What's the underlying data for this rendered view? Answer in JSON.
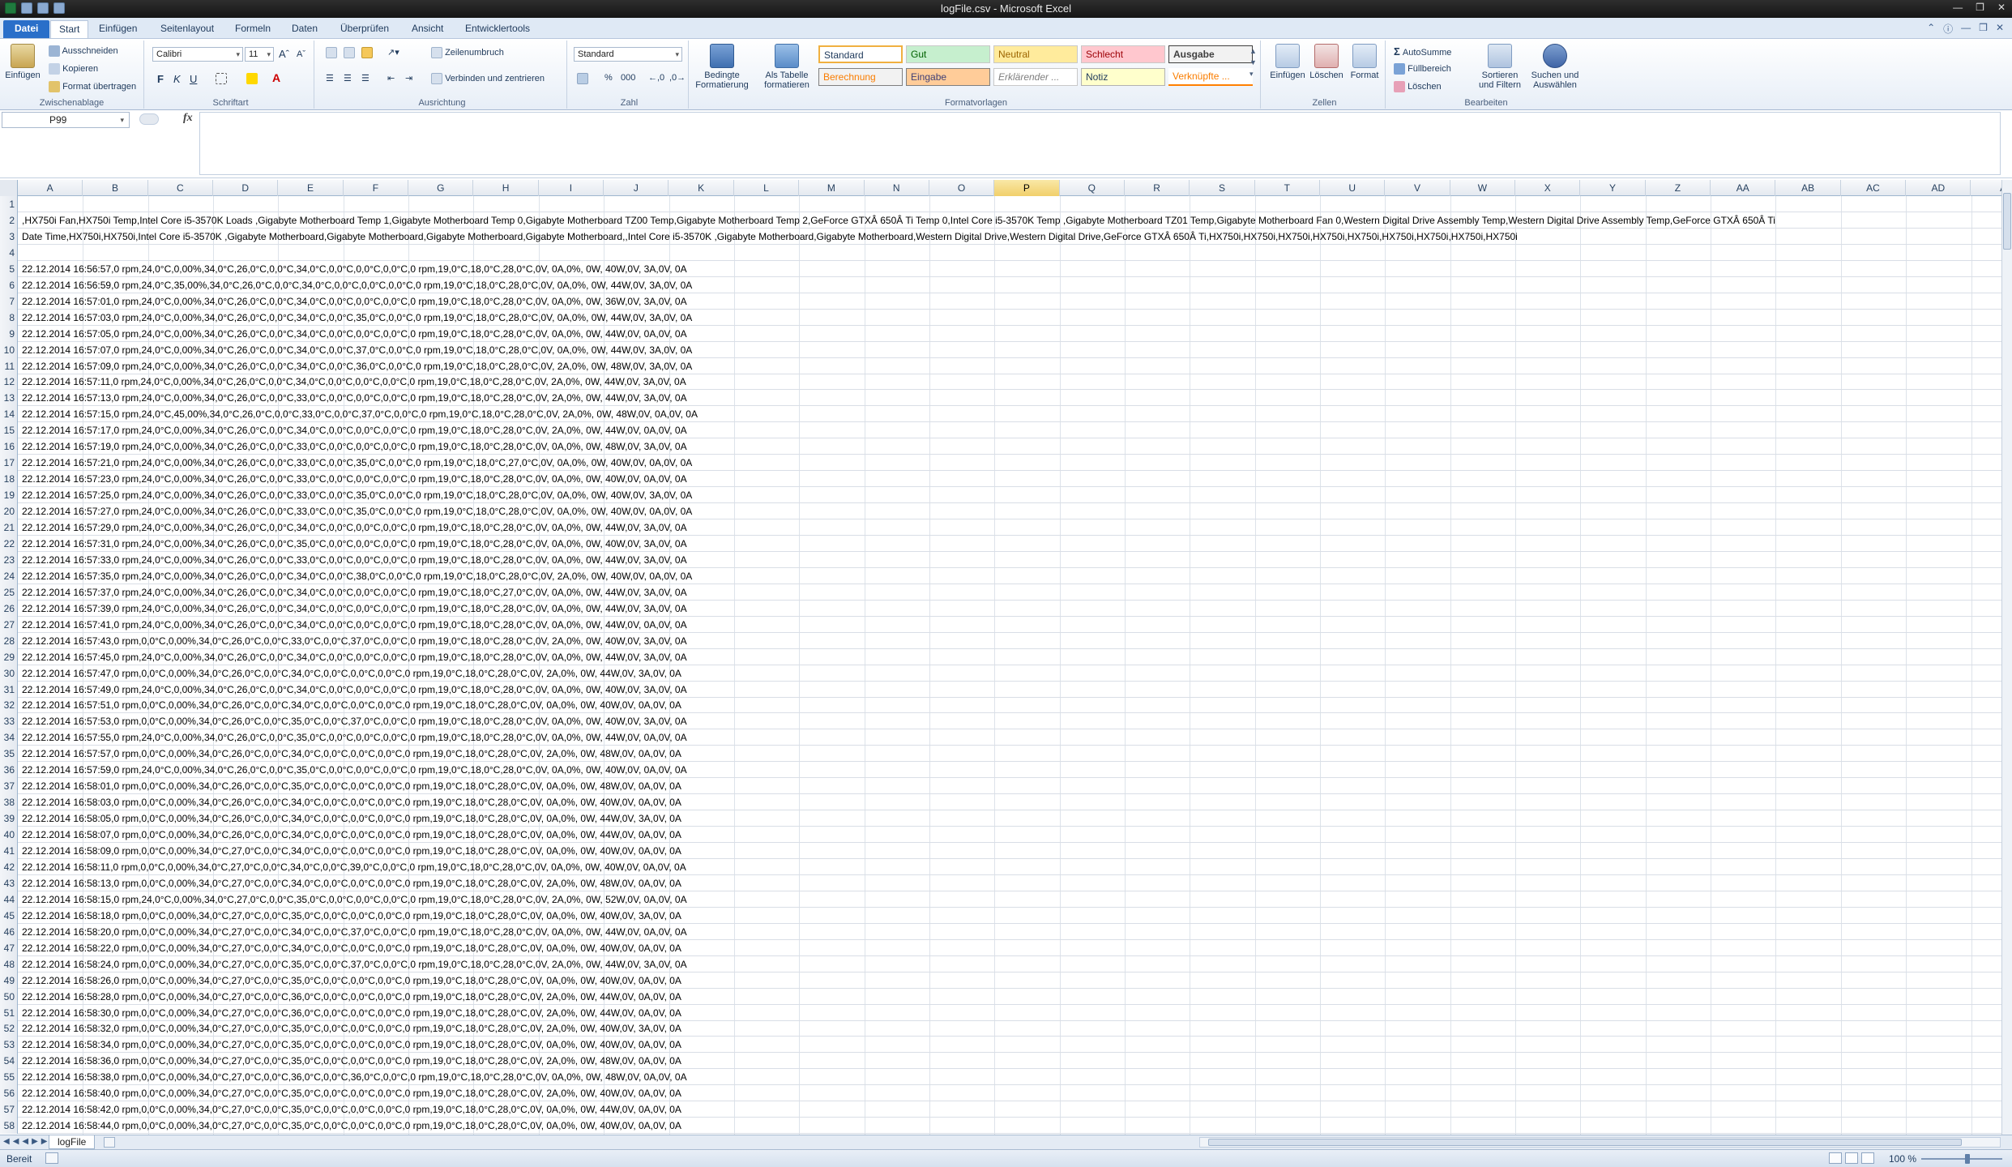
{
  "window": {
    "title": "logFile.csv - Microsoft Excel"
  },
  "tabs": [
    "Datei",
    "Start",
    "Einfügen",
    "Seitenlayout",
    "Formeln",
    "Daten",
    "Überprüfen",
    "Ansicht",
    "Entwicklertools"
  ],
  "ribbon": {
    "clipboard": {
      "paste": "Einfügen",
      "cut": "Ausschneiden",
      "copy": "Kopieren",
      "format_painter": "Format übertragen",
      "label": "Zwischenablage"
    },
    "font": {
      "family": "Calibri",
      "size": "11",
      "bold": "F",
      "italic": "K",
      "underline": "U",
      "label": "Schriftart"
    },
    "alignment": {
      "wrap": "Zeilenumbruch",
      "merge": "Verbinden und zentrieren",
      "label": "Ausrichtung"
    },
    "number": {
      "format": "Standard",
      "percent": "%",
      "thousands": "000",
      "label": "Zahl"
    },
    "styles": {
      "conditional": "Bedingte Formatierung",
      "table": "Als Tabelle formatieren",
      "label": "Formatvorlagen",
      "items": [
        "Standard",
        "Gut",
        "Neutral",
        "Schlecht",
        "Ausgabe",
        "Berechnung",
        "Eingabe",
        "Erklärender ...",
        "Notiz",
        "Verknüpfte ..."
      ]
    },
    "cells": {
      "insert": "Einfügen",
      "delete": "Löschen",
      "format": "Format",
      "label": "Zellen"
    },
    "editing": {
      "autosum": "AutoSumme",
      "fill": "Füllbereich",
      "clear": "Löschen",
      "sort": "Sortieren und Filtern",
      "find": "Suchen und Auswählen",
      "label": "Bearbeiten"
    }
  },
  "formula_bar": {
    "name_box": "P99",
    "fx": "fx",
    "formula": ""
  },
  "columns": [
    "A",
    "B",
    "C",
    "D",
    "E",
    "F",
    "G",
    "H",
    "I",
    "J",
    "K",
    "L",
    "M",
    "N",
    "O",
    "P",
    "Q",
    "R",
    "S",
    "T",
    "U",
    "V",
    "W",
    "X",
    "Y",
    "Z",
    "AA",
    "AB",
    "AC",
    "AD",
    "A"
  ],
  "selected_column": "P",
  "rows": [
    {
      "n": "1",
      "t": ""
    },
    {
      "n": "2",
      "t": ",HX750i Fan,HX750i Temp,Intel Core i5-3570K Loads ,Gigabyte Motherboard Temp 1,Gigabyte Motherboard Temp 0,Gigabyte Motherboard TZ00 Temp,Gigabyte Motherboard Temp 2,GeForce GTXÂ 650Â Ti Temp 0,Intel Core i5-3570K Temp ,Gigabyte Motherboard TZ01 Temp,Gigabyte Motherboard Fan 0,Western Digital Drive Assembly Temp,Western Digital Drive Assembly Temp,GeForce GTXÂ 650Â Ti"
    },
    {
      "n": "3",
      "t": "Date Time,HX750i,HX750i,Intel Core i5-3570K ,Gigabyte Motherboard,Gigabyte Motherboard,Gigabyte Motherboard,Gigabyte Motherboard,,Intel Core i5-3570K ,Gigabyte Motherboard,Gigabyte Motherboard,Western Digital Drive,Western Digital Drive,GeForce GTXÂ 650Â Ti,HX750i,HX750i,HX750i,HX750i,HX750i,HX750i,HX750i,HX750i,HX750i"
    },
    {
      "n": "4",
      "t": ""
    },
    {
      "n": "5",
      "t": "22.12.2014 16:56:57,0 rpm,24,0°C,0,00%,34,0°C,26,0°C,0,0°C,34,0°C,0,0°C,0,0°C,0,0°C,0 rpm,19,0°C,18,0°C,28,0°C,0V, 0A,0%, 0W, 40W,0V, 3A,0V, 0A"
    },
    {
      "n": "6",
      "t": "22.12.2014 16:56:59,0 rpm,24,0°C,35,00%,34,0°C,26,0°C,0,0°C,34,0°C,0,0°C,0,0°C,0,0°C,0 rpm,19,0°C,18,0°C,28,0°C,0V, 0A,0%, 0W, 44W,0V, 3A,0V, 0A"
    },
    {
      "n": "7",
      "t": "22.12.2014 16:57:01,0 rpm,24,0°C,0,00%,34,0°C,26,0°C,0,0°C,34,0°C,0,0°C,0,0°C,0,0°C,0 rpm,19,0°C,18,0°C,28,0°C,0V, 0A,0%, 0W, 36W,0V, 3A,0V, 0A"
    },
    {
      "n": "8",
      "t": "22.12.2014 16:57:03,0 rpm,24,0°C,0,00%,34,0°C,26,0°C,0,0°C,34,0°C,0,0°C,35,0°C,0,0°C,0 rpm,19,0°C,18,0°C,28,0°C,0V, 0A,0%, 0W, 44W,0V, 3A,0V, 0A"
    },
    {
      "n": "9",
      "t": "22.12.2014 16:57:05,0 rpm,24,0°C,0,00%,34,0°C,26,0°C,0,0°C,34,0°C,0,0°C,0,0°C,0,0°C,0 rpm,19,0°C,18,0°C,28,0°C,0V, 0A,0%, 0W, 44W,0V, 0A,0V, 0A"
    },
    {
      "n": "10",
      "t": "22.12.2014 16:57:07,0 rpm,24,0°C,0,00%,34,0°C,26,0°C,0,0°C,34,0°C,0,0°C,37,0°C,0,0°C,0 rpm,19,0°C,18,0°C,28,0°C,0V, 0A,0%, 0W, 44W,0V, 3A,0V, 0A"
    },
    {
      "n": "11",
      "t": "22.12.2014 16:57:09,0 rpm,24,0°C,0,00%,34,0°C,26,0°C,0,0°C,34,0°C,0,0°C,36,0°C,0,0°C,0 rpm,19,0°C,18,0°C,28,0°C,0V, 2A,0%, 0W, 48W,0V, 3A,0V, 0A"
    },
    {
      "n": "12",
      "t": "22.12.2014 16:57:11,0 rpm,24,0°C,0,00%,34,0°C,26,0°C,0,0°C,34,0°C,0,0°C,0,0°C,0,0°C,0 rpm,19,0°C,18,0°C,28,0°C,0V, 2A,0%, 0W, 44W,0V, 3A,0V, 0A"
    },
    {
      "n": "13",
      "t": "22.12.2014 16:57:13,0 rpm,24,0°C,0,00%,34,0°C,26,0°C,0,0°C,33,0°C,0,0°C,0,0°C,0,0°C,0 rpm,19,0°C,18,0°C,28,0°C,0V, 2A,0%, 0W, 44W,0V, 3A,0V, 0A"
    },
    {
      "n": "14",
      "t": "22.12.2014 16:57:15,0 rpm,24,0°C,45,00%,34,0°C,26,0°C,0,0°C,33,0°C,0,0°C,37,0°C,0,0°C,0 rpm,19,0°C,18,0°C,28,0°C,0V, 2A,0%, 0W, 48W,0V, 0A,0V, 0A"
    },
    {
      "n": "15",
      "t": "22.12.2014 16:57:17,0 rpm,24,0°C,0,00%,34,0°C,26,0°C,0,0°C,34,0°C,0,0°C,0,0°C,0,0°C,0 rpm,19,0°C,18,0°C,28,0°C,0V, 2A,0%, 0W, 44W,0V, 0A,0V, 0A"
    },
    {
      "n": "16",
      "t": "22.12.2014 16:57:19,0 rpm,24,0°C,0,00%,34,0°C,26,0°C,0,0°C,33,0°C,0,0°C,0,0°C,0,0°C,0 rpm,19,0°C,18,0°C,28,0°C,0V, 0A,0%, 0W, 48W,0V, 3A,0V, 0A"
    },
    {
      "n": "17",
      "t": "22.12.2014 16:57:21,0 rpm,24,0°C,0,00%,34,0°C,26,0°C,0,0°C,33,0°C,0,0°C,35,0°C,0,0°C,0 rpm,19,0°C,18,0°C,27,0°C,0V, 0A,0%, 0W, 40W,0V, 0A,0V, 0A"
    },
    {
      "n": "18",
      "t": "22.12.2014 16:57:23,0 rpm,24,0°C,0,00%,34,0°C,26,0°C,0,0°C,33,0°C,0,0°C,0,0°C,0,0°C,0 rpm,19,0°C,18,0°C,28,0°C,0V, 0A,0%, 0W, 40W,0V, 0A,0V, 0A"
    },
    {
      "n": "19",
      "t": "22.12.2014 16:57:25,0 rpm,24,0°C,0,00%,34,0°C,26,0°C,0,0°C,33,0°C,0,0°C,35,0°C,0,0°C,0 rpm,19,0°C,18,0°C,28,0°C,0V, 0A,0%, 0W, 40W,0V, 3A,0V, 0A"
    },
    {
      "n": "20",
      "t": "22.12.2014 16:57:27,0 rpm,24,0°C,0,00%,34,0°C,26,0°C,0,0°C,33,0°C,0,0°C,35,0°C,0,0°C,0 rpm,19,0°C,18,0°C,28,0°C,0V, 0A,0%, 0W, 40W,0V, 0A,0V, 0A"
    },
    {
      "n": "21",
      "t": "22.12.2014 16:57:29,0 rpm,24,0°C,0,00%,34,0°C,26,0°C,0,0°C,34,0°C,0,0°C,0,0°C,0,0°C,0 rpm,19,0°C,18,0°C,28,0°C,0V, 0A,0%, 0W, 44W,0V, 3A,0V, 0A"
    },
    {
      "n": "22",
      "t": "22.12.2014 16:57:31,0 rpm,24,0°C,0,00%,34,0°C,26,0°C,0,0°C,35,0°C,0,0°C,0,0°C,0,0°C,0 rpm,19,0°C,18,0°C,28,0°C,0V, 0A,0%, 0W, 40W,0V, 3A,0V, 0A"
    },
    {
      "n": "23",
      "t": "22.12.2014 16:57:33,0 rpm,24,0°C,0,00%,34,0°C,26,0°C,0,0°C,33,0°C,0,0°C,0,0°C,0,0°C,0 rpm,19,0°C,18,0°C,28,0°C,0V, 0A,0%, 0W, 44W,0V, 3A,0V, 0A"
    },
    {
      "n": "24",
      "t": "22.12.2014 16:57:35,0 rpm,24,0°C,0,00%,34,0°C,26,0°C,0,0°C,34,0°C,0,0°C,38,0°C,0,0°C,0 rpm,19,0°C,18,0°C,28,0°C,0V, 2A,0%, 0W, 40W,0V, 0A,0V, 0A"
    },
    {
      "n": "25",
      "t": "22.12.2014 16:57:37,0 rpm,24,0°C,0,00%,34,0°C,26,0°C,0,0°C,34,0°C,0,0°C,0,0°C,0,0°C,0 rpm,19,0°C,18,0°C,27,0°C,0V, 0A,0%, 0W, 44W,0V, 3A,0V, 0A"
    },
    {
      "n": "26",
      "t": "22.12.2014 16:57:39,0 rpm,24,0°C,0,00%,34,0°C,26,0°C,0,0°C,34,0°C,0,0°C,0,0°C,0,0°C,0 rpm,19,0°C,18,0°C,28,0°C,0V, 0A,0%, 0W, 44W,0V, 3A,0V, 0A"
    },
    {
      "n": "27",
      "t": "22.12.2014 16:57:41,0 rpm,24,0°C,0,00%,34,0°C,26,0°C,0,0°C,34,0°C,0,0°C,0,0°C,0,0°C,0 rpm,19,0°C,18,0°C,28,0°C,0V, 0A,0%, 0W, 44W,0V, 0A,0V, 0A"
    },
    {
      "n": "28",
      "t": "22.12.2014 16:57:43,0 rpm,0,0°C,0,00%,34,0°C,26,0°C,0,0°C,33,0°C,0,0°C,37,0°C,0,0°C,0 rpm,19,0°C,18,0°C,28,0°C,0V, 2A,0%, 0W, 40W,0V, 3A,0V, 0A"
    },
    {
      "n": "29",
      "t": "22.12.2014 16:57:45,0 rpm,24,0°C,0,00%,34,0°C,26,0°C,0,0°C,34,0°C,0,0°C,0,0°C,0,0°C,0 rpm,19,0°C,18,0°C,28,0°C,0V, 0A,0%, 0W, 44W,0V, 3A,0V, 0A"
    },
    {
      "n": "30",
      "t": "22.12.2014 16:57:47,0 rpm,0,0°C,0,00%,34,0°C,26,0°C,0,0°C,34,0°C,0,0°C,0,0°C,0,0°C,0 rpm,19,0°C,18,0°C,28,0°C,0V, 2A,0%, 0W, 44W,0V, 3A,0V, 0A"
    },
    {
      "n": "31",
      "t": "22.12.2014 16:57:49,0 rpm,24,0°C,0,00%,34,0°C,26,0°C,0,0°C,34,0°C,0,0°C,0,0°C,0,0°C,0 rpm,19,0°C,18,0°C,28,0°C,0V, 0A,0%, 0W, 40W,0V, 3A,0V, 0A"
    },
    {
      "n": "32",
      "t": "22.12.2014 16:57:51,0 rpm,0,0°C,0,00%,34,0°C,26,0°C,0,0°C,34,0°C,0,0°C,0,0°C,0,0°C,0 rpm,19,0°C,18,0°C,28,0°C,0V, 0A,0%, 0W, 40W,0V, 0A,0V, 0A"
    },
    {
      "n": "33",
      "t": "22.12.2014 16:57:53,0 rpm,0,0°C,0,00%,34,0°C,26,0°C,0,0°C,35,0°C,0,0°C,37,0°C,0,0°C,0 rpm,19,0°C,18,0°C,28,0°C,0V, 0A,0%, 0W, 40W,0V, 3A,0V, 0A"
    },
    {
      "n": "34",
      "t": "22.12.2014 16:57:55,0 rpm,24,0°C,0,00%,34,0°C,26,0°C,0,0°C,35,0°C,0,0°C,0,0°C,0,0°C,0 rpm,19,0°C,18,0°C,28,0°C,0V, 0A,0%, 0W, 44W,0V, 0A,0V, 0A"
    },
    {
      "n": "35",
      "t": "22.12.2014 16:57:57,0 rpm,0,0°C,0,00%,34,0°C,26,0°C,0,0°C,34,0°C,0,0°C,0,0°C,0,0°C,0 rpm,19,0°C,18,0°C,28,0°C,0V, 2A,0%, 0W, 48W,0V, 0A,0V, 0A"
    },
    {
      "n": "36",
      "t": "22.12.2014 16:57:59,0 rpm,24,0°C,0,00%,34,0°C,26,0°C,0,0°C,35,0°C,0,0°C,0,0°C,0,0°C,0 rpm,19,0°C,18,0°C,28,0°C,0V, 0A,0%, 0W, 40W,0V, 0A,0V, 0A"
    },
    {
      "n": "37",
      "t": "22.12.2014 16:58:01,0 rpm,0,0°C,0,00%,34,0°C,26,0°C,0,0°C,35,0°C,0,0°C,0,0°C,0,0°C,0 rpm,19,0°C,18,0°C,28,0°C,0V, 0A,0%, 0W, 48W,0V, 0A,0V, 0A"
    },
    {
      "n": "38",
      "t": "22.12.2014 16:58:03,0 rpm,0,0°C,0,00%,34,0°C,26,0°C,0,0°C,34,0°C,0,0°C,0,0°C,0,0°C,0 rpm,19,0°C,18,0°C,28,0°C,0V, 0A,0%, 0W, 40W,0V, 0A,0V, 0A"
    },
    {
      "n": "39",
      "t": "22.12.2014 16:58:05,0 rpm,0,0°C,0,00%,34,0°C,26,0°C,0,0°C,34,0°C,0,0°C,0,0°C,0,0°C,0 rpm,19,0°C,18,0°C,28,0°C,0V, 0A,0%, 0W, 44W,0V, 3A,0V, 0A"
    },
    {
      "n": "40",
      "t": "22.12.2014 16:58:07,0 rpm,0,0°C,0,00%,34,0°C,26,0°C,0,0°C,34,0°C,0,0°C,0,0°C,0,0°C,0 rpm,19,0°C,18,0°C,28,0°C,0V, 0A,0%, 0W, 44W,0V, 0A,0V, 0A"
    },
    {
      "n": "41",
      "t": "22.12.2014 16:58:09,0 rpm,0,0°C,0,00%,34,0°C,27,0°C,0,0°C,34,0°C,0,0°C,0,0°C,0,0°C,0 rpm,19,0°C,18,0°C,28,0°C,0V, 0A,0%, 0W, 40W,0V, 0A,0V, 0A"
    },
    {
      "n": "42",
      "t": "22.12.2014 16:58:11,0 rpm,0,0°C,0,00%,34,0°C,27,0°C,0,0°C,34,0°C,0,0°C,39,0°C,0,0°C,0 rpm,19,0°C,18,0°C,28,0°C,0V, 0A,0%, 0W, 40W,0V, 0A,0V, 0A"
    },
    {
      "n": "43",
      "t": "22.12.2014 16:58:13,0 rpm,0,0°C,0,00%,34,0°C,27,0°C,0,0°C,34,0°C,0,0°C,0,0°C,0,0°C,0 rpm,19,0°C,18,0°C,28,0°C,0V, 2A,0%, 0W, 48W,0V, 0A,0V, 0A"
    },
    {
      "n": "44",
      "t": "22.12.2014 16:58:15,0 rpm,24,0°C,0,00%,34,0°C,27,0°C,0,0°C,35,0°C,0,0°C,0,0°C,0,0°C,0 rpm,19,0°C,18,0°C,28,0°C,0V, 2A,0%, 0W, 52W,0V, 0A,0V, 0A"
    },
    {
      "n": "45",
      "t": "22.12.2014 16:58:18,0 rpm,0,0°C,0,00%,34,0°C,27,0°C,0,0°C,35,0°C,0,0°C,0,0°C,0,0°C,0 rpm,19,0°C,18,0°C,28,0°C,0V, 0A,0%, 0W, 40W,0V, 3A,0V, 0A"
    },
    {
      "n": "46",
      "t": "22.12.2014 16:58:20,0 rpm,0,0°C,0,00%,34,0°C,27,0°C,0,0°C,34,0°C,0,0°C,37,0°C,0,0°C,0 rpm,19,0°C,18,0°C,28,0°C,0V, 0A,0%, 0W, 44W,0V, 0A,0V, 0A"
    },
    {
      "n": "47",
      "t": "22.12.2014 16:58:22,0 rpm,0,0°C,0,00%,34,0°C,27,0°C,0,0°C,34,0°C,0,0°C,0,0°C,0,0°C,0 rpm,19,0°C,18,0°C,28,0°C,0V, 0A,0%, 0W, 40W,0V, 0A,0V, 0A"
    },
    {
      "n": "48",
      "t": "22.12.2014 16:58:24,0 rpm,0,0°C,0,00%,34,0°C,27,0°C,0,0°C,35,0°C,0,0°C,37,0°C,0,0°C,0 rpm,19,0°C,18,0°C,28,0°C,0V, 2A,0%, 0W, 44W,0V, 3A,0V, 0A"
    },
    {
      "n": "49",
      "t": "22.12.2014 16:58:26,0 rpm,0,0°C,0,00%,34,0°C,27,0°C,0,0°C,35,0°C,0,0°C,0,0°C,0,0°C,0 rpm,19,0°C,18,0°C,28,0°C,0V, 0A,0%, 0W, 40W,0V, 0A,0V, 0A"
    },
    {
      "n": "50",
      "t": "22.12.2014 16:58:28,0 rpm,0,0°C,0,00%,34,0°C,27,0°C,0,0°C,36,0°C,0,0°C,0,0°C,0,0°C,0 rpm,19,0°C,18,0°C,28,0°C,0V, 2A,0%, 0W, 44W,0V, 0A,0V, 0A"
    },
    {
      "n": "51",
      "t": "22.12.2014 16:58:30,0 rpm,0,0°C,0,00%,34,0°C,27,0°C,0,0°C,36,0°C,0,0°C,0,0°C,0,0°C,0 rpm,19,0°C,18,0°C,28,0°C,0V, 2A,0%, 0W, 44W,0V, 0A,0V, 0A"
    },
    {
      "n": "52",
      "t": "22.12.2014 16:58:32,0 rpm,0,0°C,0,00%,34,0°C,27,0°C,0,0°C,35,0°C,0,0°C,0,0°C,0,0°C,0 rpm,19,0°C,18,0°C,28,0°C,0V, 2A,0%, 0W, 40W,0V, 3A,0V, 0A"
    },
    {
      "n": "53",
      "t": "22.12.2014 16:58:34,0 rpm,0,0°C,0,00%,34,0°C,27,0°C,0,0°C,35,0°C,0,0°C,0,0°C,0,0°C,0 rpm,19,0°C,18,0°C,28,0°C,0V, 0A,0%, 0W, 40W,0V, 0A,0V, 0A"
    },
    {
      "n": "54",
      "t": "22.12.2014 16:58:36,0 rpm,0,0°C,0,00%,34,0°C,27,0°C,0,0°C,35,0°C,0,0°C,0,0°C,0,0°C,0 rpm,19,0°C,18,0°C,28,0°C,0V, 2A,0%, 0W, 48W,0V, 0A,0V, 0A"
    },
    {
      "n": "55",
      "t": "22.12.2014 16:58:38,0 rpm,0,0°C,0,00%,34,0°C,27,0°C,0,0°C,36,0°C,0,0°C,36,0°C,0,0°C,0 rpm,19,0°C,18,0°C,28,0°C,0V, 0A,0%, 0W, 48W,0V, 0A,0V, 0A"
    },
    {
      "n": "56",
      "t": "22.12.2014 16:58:40,0 rpm,0,0°C,0,00%,34,0°C,27,0°C,0,0°C,35,0°C,0,0°C,0,0°C,0,0°C,0 rpm,19,0°C,18,0°C,28,0°C,0V, 2A,0%, 0W, 40W,0V, 0A,0V, 0A"
    },
    {
      "n": "57",
      "t": "22.12.2014 16:58:42,0 rpm,0,0°C,0,00%,34,0°C,27,0°C,0,0°C,35,0°C,0,0°C,0,0°C,0,0°C,0 rpm,19,0°C,18,0°C,28,0°C,0V, 0A,0%, 0W, 44W,0V, 0A,0V, 0A"
    },
    {
      "n": "58",
      "t": "22.12.2014 16:58:44,0 rpm,0,0°C,0,00%,34,0°C,27,0°C,0,0°C,35,0°C,0,0°C,0,0°C,0,0°C,0 rpm,19,0°C,18,0°C,28,0°C,0V, 0A,0%, 0W, 40W,0V, 0A,0V, 0A"
    }
  ],
  "sheet": {
    "name": "logFile"
  },
  "status": {
    "ready": "Bereit",
    "zoom": "100 %"
  },
  "colors": {
    "accent": "#2a6fc9",
    "selected_header": "#f1cf6a"
  }
}
